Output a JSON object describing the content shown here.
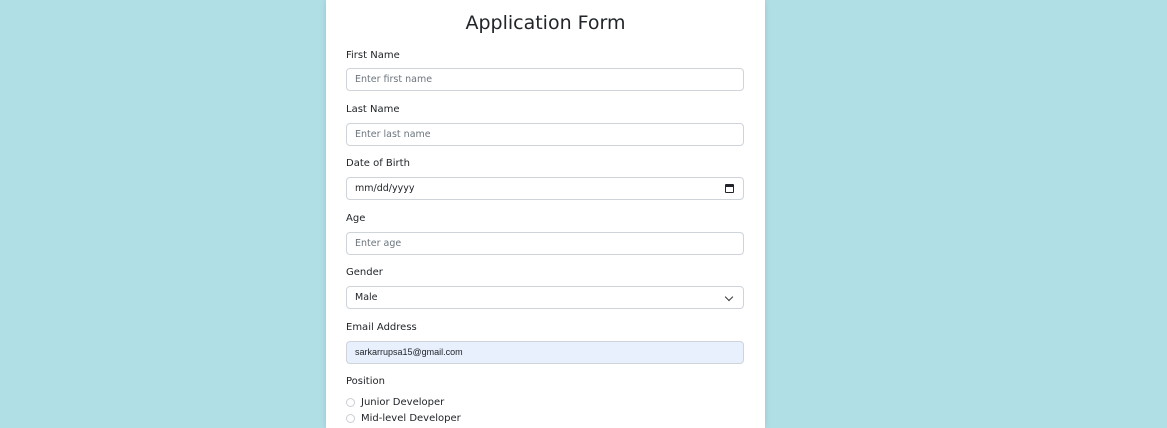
{
  "form": {
    "title": "Application Form",
    "first_name": {
      "label": "First Name",
      "placeholder": "Enter first name"
    },
    "last_name": {
      "label": "Last Name",
      "placeholder": "Enter last name"
    },
    "dob": {
      "label": "Date of Birth",
      "placeholder": "mm/dd/yyyy"
    },
    "age": {
      "label": "Age",
      "placeholder": "Enter age"
    },
    "gender": {
      "label": "Gender",
      "selected": "Male"
    },
    "email": {
      "label": "Email Address",
      "value": "sarkarrupsa15@gmail.com"
    },
    "position": {
      "label": "Position",
      "options": [
        "Junior Developer",
        "Mid-level Developer"
      ]
    }
  },
  "colors": {
    "background": "#b0dfe5",
    "card": "#ffffff",
    "autofill": "#e8f0fe"
  }
}
